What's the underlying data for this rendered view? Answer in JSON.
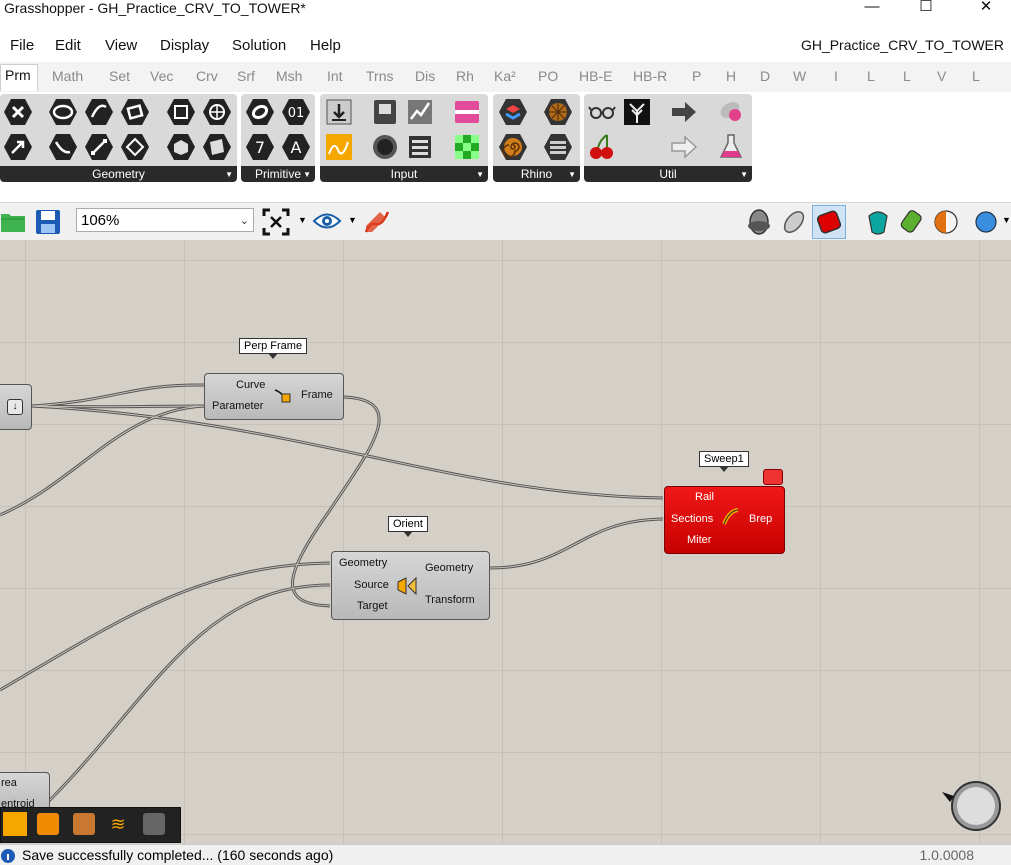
{
  "window": {
    "title": "Grasshopper - GH_Practice_CRV_TO_TOWER*",
    "minimize": "—",
    "maximize": "☐",
    "close": "✕"
  },
  "menubar": {
    "items": [
      "File",
      "Edit",
      "View",
      "Display",
      "Solution",
      "Help"
    ],
    "document_name": "GH_Practice_CRV_TO_TOWER"
  },
  "tabs": [
    "Prm",
    "Math",
    "Set",
    "Vec",
    "Crv",
    "Srf",
    "Msh",
    "Int",
    "Trns",
    "Dis",
    "Rh",
    "Ka²",
    "PO",
    "HB-E",
    "HB-R",
    "P",
    "H",
    "D",
    "W",
    "I",
    "L",
    "L",
    "V",
    "L"
  ],
  "ribbon_groups": [
    {
      "label": "Geometry"
    },
    {
      "label": "Primitive"
    },
    {
      "label": "Input"
    },
    {
      "label": "Rhino"
    },
    {
      "label": "Util"
    }
  ],
  "toolbar": {
    "zoom": "106%"
  },
  "nodes": {
    "perp_frame": {
      "name": "Perp Frame",
      "inputs": [
        "Curve",
        "Parameter"
      ],
      "outputs": [
        "Frame"
      ]
    },
    "orient": {
      "name": "Orient",
      "inputs": [
        "Geometry",
        "Source",
        "Target"
      ],
      "outputs": [
        "Geometry",
        "Transform"
      ]
    },
    "sweep": {
      "name": "Sweep1",
      "inputs": [
        "Rail",
        "Sections",
        "Miter"
      ],
      "outputs": [
        "Brep"
      ]
    },
    "area": {
      "outputs": [
        "rea",
        "entroid"
      ]
    }
  },
  "status": {
    "message": "Save successfully completed... (160 seconds ago)",
    "version": "1.0.0008"
  },
  "colors": {
    "canvas": "#d4d0c8",
    "error_node": "#e00000",
    "ribbon_label": "#2a2a2a"
  }
}
